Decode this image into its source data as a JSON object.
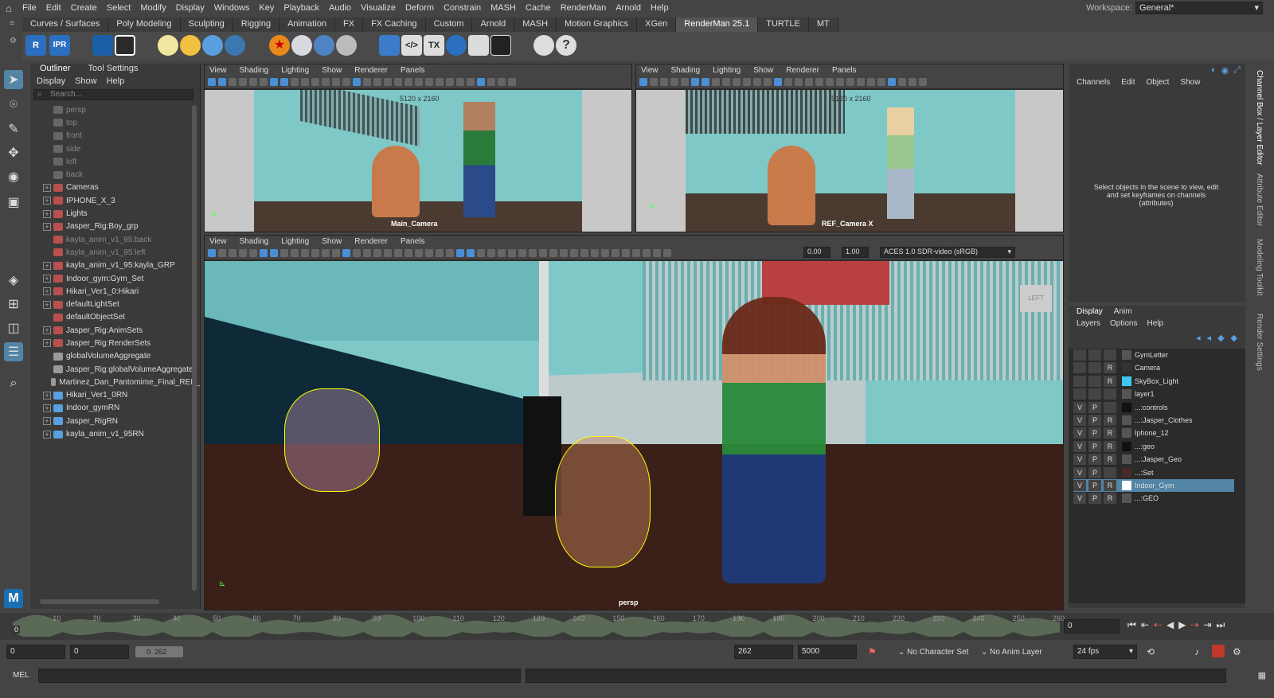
{
  "menubar": {
    "items": [
      "File",
      "Edit",
      "Create",
      "Select",
      "Modify",
      "Display",
      "Windows",
      "Key",
      "Playback",
      "Audio",
      "Visualize",
      "Deform",
      "Constrain",
      "MASH",
      "Cache",
      "RenderMan",
      "Arnold",
      "Help"
    ],
    "workspace_label": "Workspace:",
    "workspace_value": "General*"
  },
  "shelf": {
    "tabs": [
      "Curves / Surfaces",
      "Poly Modeling",
      "Sculpting",
      "Rigging",
      "Animation",
      "FX",
      "FX Caching",
      "Custom",
      "Arnold",
      "MASH",
      "Motion Graphics",
      "XGen",
      "RenderMan 25.1",
      "TURTLE",
      "MT"
    ],
    "active_tab": "RenderMan 25.1",
    "icons": [
      "renderman-render-icon",
      "ipr-icon",
      "render-view-icon",
      "clapper-icon",
      "sun-icon",
      "light-icon",
      "dome-light-icon",
      "portal-light-icon",
      "star-icon",
      "sky-icon",
      "gear-light-icon",
      "sphere-icon",
      "cube-icon",
      "code-icon",
      "tx-icon",
      "moon-icon",
      "chart-icon",
      "wave-icon",
      "hook-icon",
      "help-icon"
    ],
    "labels": {
      "r": "R",
      "ipr": "IPR",
      "tx": "TX"
    }
  },
  "outliner": {
    "tabs": [
      "Outliner",
      "Tool Settings"
    ],
    "menu": [
      "Display",
      "Show",
      "Help"
    ],
    "search_placeholder": "Search...",
    "items": [
      {
        "label": "persp",
        "dim": true,
        "expand": ""
      },
      {
        "label": "top",
        "dim": true,
        "expand": ""
      },
      {
        "label": "front",
        "dim": true,
        "expand": ""
      },
      {
        "label": "side",
        "dim": true,
        "expand": ""
      },
      {
        "label": "left",
        "dim": true,
        "expand": ""
      },
      {
        "label": "back",
        "dim": true,
        "expand": ""
      },
      {
        "label": "Cameras",
        "dim": false,
        "expand": "+"
      },
      {
        "label": "IPHONE_X_3",
        "dim": false,
        "expand": "+"
      },
      {
        "label": "Lights",
        "dim": false,
        "expand": "+"
      },
      {
        "label": "Jasper_Rig:Boy_grp",
        "dim": false,
        "expand": "+"
      },
      {
        "label": "kayla_anim_v1_95:back",
        "dim": true,
        "expand": ""
      },
      {
        "label": "kayla_anim_v1_95:left",
        "dim": true,
        "expand": ""
      },
      {
        "label": "kayla_anim_v1_95:kayla_GRP",
        "dim": false,
        "expand": "+"
      },
      {
        "label": "Indoor_gym:Gym_Set",
        "dim": false,
        "expand": "+"
      },
      {
        "label": "Hikari_Ver1_0:Hikari",
        "dim": false,
        "expand": "+"
      },
      {
        "label": "defaultLightSet",
        "dim": false,
        "expand": "+"
      },
      {
        "label": "defaultObjectSet",
        "dim": false,
        "expand": ""
      },
      {
        "label": "Jasper_Rig:AnimSets",
        "dim": false,
        "expand": "+"
      },
      {
        "label": "Jasper_Rig:RenderSets",
        "dim": false,
        "expand": "+"
      },
      {
        "label": "globalVolumeAggregate",
        "dim": false,
        "expand": ""
      },
      {
        "label": "Jasper_Rig:globalVolumeAggregate",
        "dim": false,
        "expand": ""
      },
      {
        "label": "Martinez_Dan_Pantomime_Final_REF_",
        "dim": false,
        "expand": ""
      },
      {
        "label": "Hikari_Ver1_0RN",
        "dim": false,
        "expand": "+"
      },
      {
        "label": "Indoor_gymRN",
        "dim": false,
        "expand": "+"
      },
      {
        "label": "Jasper_RigRN",
        "dim": false,
        "expand": "+"
      },
      {
        "label": "kayla_anim_v1_95RN",
        "dim": false,
        "expand": "+"
      }
    ]
  },
  "viewports": {
    "menu": [
      "View",
      "Shading",
      "Lighting",
      "Show",
      "Renderer",
      "Panels"
    ],
    "top_left": {
      "resolution": "5120 x 2160",
      "camera": "Main_Camera"
    },
    "top_right": {
      "resolution": "5120 x 2160",
      "camera": "REF_Camera X"
    },
    "main": {
      "camera": "persp",
      "exposure": "0.00",
      "gamma": "1.00",
      "colorspace": "ACES 1.0 SDR-video (sRGB)",
      "viewcube": "LEFT"
    }
  },
  "channel_box": {
    "menu": [
      "Channels",
      "Edit",
      "Object",
      "Show"
    ],
    "message": "Select objects in the scene to view, edit and set keyframes on channels (attributes)"
  },
  "layer_editor": {
    "tabs": [
      "Display",
      "Anim"
    ],
    "menu": [
      "Layers",
      "Options",
      "Help"
    ],
    "layers": [
      {
        "v": "",
        "p": "",
        "r": "",
        "name": "GymLetter",
        "color": "#555555",
        "selected": false
      },
      {
        "v": "",
        "p": "",
        "r": "R",
        "name": "Camera",
        "color": "#333333",
        "selected": false
      },
      {
        "v": "",
        "p": "",
        "r": "R",
        "name": "SkyBox_Light",
        "color": "#3cc8f0",
        "selected": false
      },
      {
        "v": "",
        "p": "",
        "r": "",
        "name": "layer1",
        "color": "#555555",
        "selected": false
      },
      {
        "v": "V",
        "p": "P",
        "r": "",
        "name": "...:controls",
        "color": "#111111",
        "selected": false
      },
      {
        "v": "V",
        "p": "P",
        "r": "R",
        "name": "...:Jasper_Clothes",
        "color": "#555555",
        "selected": false
      },
      {
        "v": "V",
        "p": "P",
        "r": "R",
        "name": "Iphone_12",
        "color": "#555555",
        "selected": false
      },
      {
        "v": "V",
        "p": "P",
        "r": "R",
        "name": "...:geo",
        "color": "#111111",
        "selected": false
      },
      {
        "v": "V",
        "p": "P",
        "r": "R",
        "name": "...:Jasper_Geo",
        "color": "#555555",
        "selected": false
      },
      {
        "v": "V",
        "p": "P",
        "r": "",
        "name": "...:Set",
        "color": "#4a2a2a",
        "selected": false
      },
      {
        "v": "V",
        "p": "P",
        "r": "R",
        "name": "Indoor_Gym",
        "color": "#ffffff",
        "selected": true
      },
      {
        "v": "V",
        "p": "P",
        "r": "R",
        "name": "...:GEO",
        "color": "#555555",
        "selected": false
      }
    ]
  },
  "side_tabs": [
    "Channel Box / Layer Editor",
    "Attribute Editor",
    "Modeling Toolkit",
    "Render Settings"
  ],
  "timeline": {
    "ticks": [
      "10",
      "20",
      "30",
      "40",
      "50",
      "60",
      "70",
      "80",
      "90",
      "100",
      "110",
      "120",
      "130",
      "140",
      "150",
      "160",
      "170",
      "180",
      "190",
      "200",
      "210",
      "220",
      "230",
      "240",
      "250",
      "260"
    ],
    "current_frame": "0",
    "current_frame_field": "0"
  },
  "range": {
    "start": "0",
    "playback_start": "0",
    "slider_start": "0",
    "slider_end": "262",
    "playback_end": "262",
    "end": "5000",
    "character_set": "No Character Set",
    "anim_layer": "No Anim Layer",
    "fps": "24 fps"
  },
  "command_line": {
    "label": "MEL"
  }
}
